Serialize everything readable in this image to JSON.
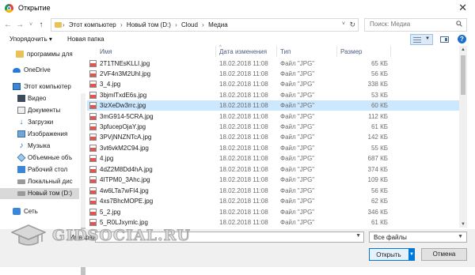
{
  "window": {
    "title": "Открытие",
    "close_glyph": "✕"
  },
  "address": {
    "back": "←",
    "forward": "→",
    "dropdown": "˅",
    "up": "↑",
    "crumbs": [
      "Этот компьютер",
      "Новый том (D:)",
      "Cloud",
      "Медиа"
    ],
    "separator": "›",
    "refresh": "↻",
    "search_placeholder": "Поиск: Медиа"
  },
  "toolbar": {
    "organize": "Упорядочить ▾",
    "new_folder": "Новая папка",
    "help": "?"
  },
  "nav": {
    "items": [
      {
        "label": "программы для",
        "icon": "folder-icon"
      },
      {
        "label": "OneDrive",
        "icon": "onedrive-icon"
      },
      {
        "label": "Этот компьютер",
        "icon": "computer-icon"
      },
      {
        "label": "Видео",
        "icon": "video-icon"
      },
      {
        "label": "Документы",
        "icon": "documents-icon"
      },
      {
        "label": "Загрузки",
        "icon": "downloads-icon"
      },
      {
        "label": "Изображения",
        "icon": "images-icon"
      },
      {
        "label": "Музыка",
        "icon": "music-icon"
      },
      {
        "label": "Объемные объ",
        "icon": "3d-objects-icon"
      },
      {
        "label": "Рабочий стол",
        "icon": "desktop-icon"
      },
      {
        "label": "Локальный дис",
        "icon": "disk-icon"
      },
      {
        "label": "Новый том (D:)",
        "icon": "disk-icon",
        "selected": true
      },
      {
        "label": "Сеть",
        "icon": "network-icon"
      }
    ]
  },
  "columns": {
    "name": "Имя",
    "date": "Дата изменения",
    "type": "Тип",
    "size": "Размер"
  },
  "files": [
    {
      "name": "2T1TNEsKLLI.jpg",
      "date": "18.02.2018 11:08",
      "type": "Файл \"JPG\"",
      "size": "65 КБ"
    },
    {
      "name": "2VF4n3M2Uhl.jpg",
      "date": "18.02.2018 11:08",
      "type": "Файл \"JPG\"",
      "size": "56 КБ"
    },
    {
      "name": "3_4.jpg",
      "date": "18.02.2018 11:08",
      "type": "Файл \"JPG\"",
      "size": "338 КБ"
    },
    {
      "name": "3bjmlTxdE6s.jpg",
      "date": "18.02.2018 11:08",
      "type": "Файл \"JPG\"",
      "size": "53 КБ"
    },
    {
      "name": "3izXeDw3rrc.jpg",
      "date": "18.02.2018 11:08",
      "type": "Файл \"JPG\"",
      "size": "60 КБ",
      "selected": true
    },
    {
      "name": "3mG914-5CRA.jpg",
      "date": "18.02.2018 11:08",
      "type": "Файл \"JPG\"",
      "size": "112 КБ"
    },
    {
      "name": "3pfucepOjaY.jpg",
      "date": "18.02.2018 11:08",
      "type": "Файл \"JPG\"",
      "size": "61 КБ"
    },
    {
      "name": "3PVjNNZNTcA.jpg",
      "date": "18.02.2018 11:08",
      "type": "Файл \"JPG\"",
      "size": "142 КБ"
    },
    {
      "name": "3vt6vkM2C94.jpg",
      "date": "18.02.2018 11:08",
      "type": "Файл \"JPG\"",
      "size": "55 КБ"
    },
    {
      "name": "4.jpg",
      "date": "18.02.2018 11:08",
      "type": "Файл \"JPG\"",
      "size": "687 КБ"
    },
    {
      "name": "4dZ2M8Dd4hA.jpg",
      "date": "18.02.2018 11:08",
      "type": "Файл \"JPG\"",
      "size": "374 КБ"
    },
    {
      "name": "4ITPM0_3Ahc.jpg",
      "date": "18.02.2018 11:08",
      "type": "Файл \"JPG\"",
      "size": "109 КБ"
    },
    {
      "name": "4w6LTa7wFI4.jpg",
      "date": "18.02.2018 11:08",
      "type": "Файл \"JPG\"",
      "size": "56 КБ"
    },
    {
      "name": "4xs7BhcMOPE.jpg",
      "date": "18.02.2018 11:08",
      "type": "Файл \"JPG\"",
      "size": "62 КБ"
    },
    {
      "name": "5_2.jpg",
      "date": "18.02.2018 11:08",
      "type": "Файл \"JPG\"",
      "size": "346 КБ"
    },
    {
      "name": "5_R0LJxymlc.jpg",
      "date": "18.02.2018 11:08",
      "type": "Файл \"JPG\"",
      "size": "61 КБ"
    }
  ],
  "footer": {
    "filename_label": "Имя файла:",
    "filter_value": "Все файлы",
    "open": "Открыть",
    "cancel": "Отмена"
  },
  "watermark": {
    "text": "GIDSOCIAL.RU"
  }
}
